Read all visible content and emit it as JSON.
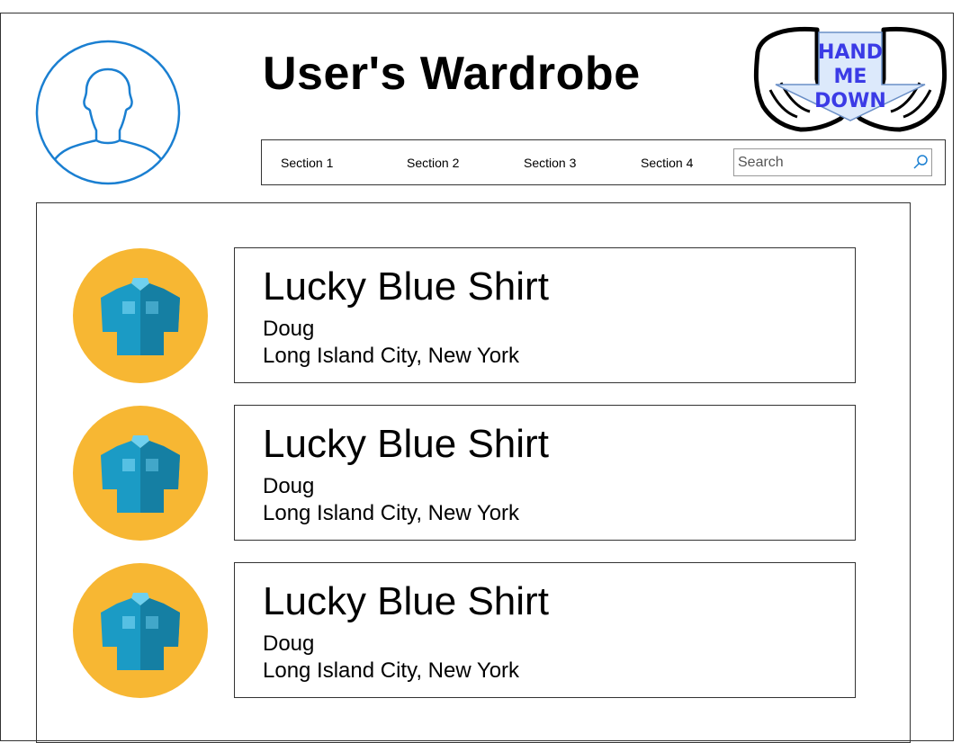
{
  "header": {
    "title": "User's Wardrobe",
    "logo_text": "HAND\nME\nDOWN"
  },
  "nav": {
    "sections": [
      "Section 1",
      "Section 2",
      "Section 3",
      "Section 4"
    ],
    "search_placeholder": "Search"
  },
  "items": [
    {
      "title": "Lucky Blue Shirt",
      "owner": "Doug",
      "location": "Long Island City, New York",
      "icon": "shirt-icon"
    },
    {
      "title": "Lucky Blue Shirt",
      "owner": "Doug",
      "location": "Long Island City, New York",
      "icon": "shirt-icon"
    },
    {
      "title": "Lucky Blue Shirt",
      "owner": "Doug",
      "location": "Long Island City, New York",
      "icon": "shirt-icon"
    }
  ],
  "colors": {
    "avatar_stroke": "#1a7fd1",
    "thumb_bg": "#f7b733",
    "shirt": "#1b9bc5",
    "shirt_dark": "#157fa3",
    "shirt_light": "#6fd0ef",
    "logo_text": "#3b3be6",
    "arrow_fill": "#dce9fb"
  }
}
